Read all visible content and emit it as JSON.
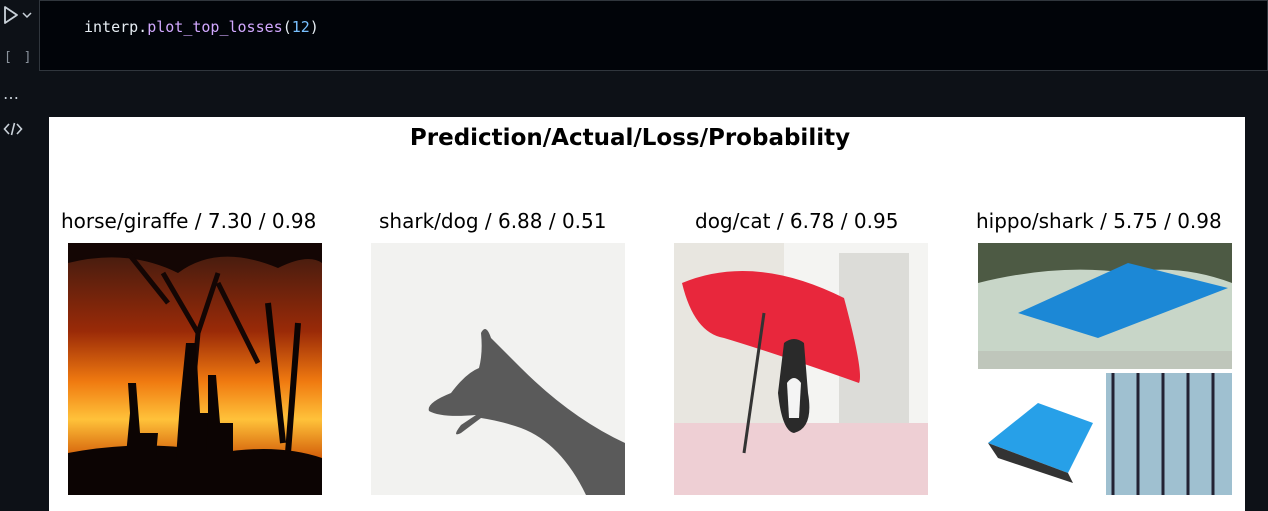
{
  "cell": {
    "code": {
      "object": "interp.",
      "method": "plot_top_losses",
      "open_paren": "(",
      "arg": "12",
      "close_paren": ")"
    },
    "exec_count": "[ ]",
    "more_glyph": "…"
  },
  "output": {
    "figure_title": "Prediction/Actual/Loss/Probability",
    "panels": [
      {
        "title": "horse/giraffe / 7.30 / 0.98",
        "image_icon": "giraffe-sunset-image"
      },
      {
        "title": "shark/dog / 6.88 / 0.51",
        "image_icon": "dog-shadow-image"
      },
      {
        "title": "dog/cat / 6.78 / 0.95",
        "image_icon": "cat-umbrella-image"
      },
      {
        "title": "hippo/shark / 5.75 / 0.98",
        "image_icon": "blue-tarp-image"
      }
    ]
  },
  "colors": {
    "background": "#0d1117",
    "method_token": "#d2a8ff",
    "number_token": "#79c0ff"
  }
}
